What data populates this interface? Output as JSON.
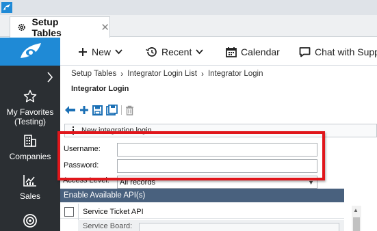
{
  "tab": {
    "label": "Setup Tables",
    "close": "✕"
  },
  "nav": {
    "new_label": "New",
    "recent_label": "Recent",
    "calendar_label": "Calendar",
    "chat_label": "Chat with Supp"
  },
  "sidebar": {
    "expand": "›",
    "items": [
      {
        "label": "My Favorites (Testing)",
        "icon": "star-icon"
      },
      {
        "label": "Companies",
        "icon": "building-icon"
      },
      {
        "label": "Sales",
        "icon": "chart-icon"
      },
      {
        "label": "",
        "icon": "target-icon"
      }
    ]
  },
  "breadcrumb": {
    "items": [
      "Setup Tables",
      "Integrator Login List",
      "Integrator Login"
    ]
  },
  "page": {
    "title": "Integrator Login"
  },
  "info": {
    "text": "New integration login"
  },
  "form": {
    "username_label": "Username:",
    "password_label": "Password:",
    "username_value": "",
    "password_value": "",
    "access_label": "Access Level:",
    "access_value": "All records"
  },
  "apis": {
    "header": "Enable Available API(s)",
    "rows": [
      {
        "name": "Service Ticket API",
        "checked": false,
        "board_label": "Service Board:"
      }
    ]
  },
  "colors": {
    "logo_blue": "#1f8ad6",
    "sidebar_bg": "#2b2f33",
    "section_header": "#49617e",
    "highlight_red": "#e0161b",
    "toolbar_blue": "#1a6fb5"
  }
}
